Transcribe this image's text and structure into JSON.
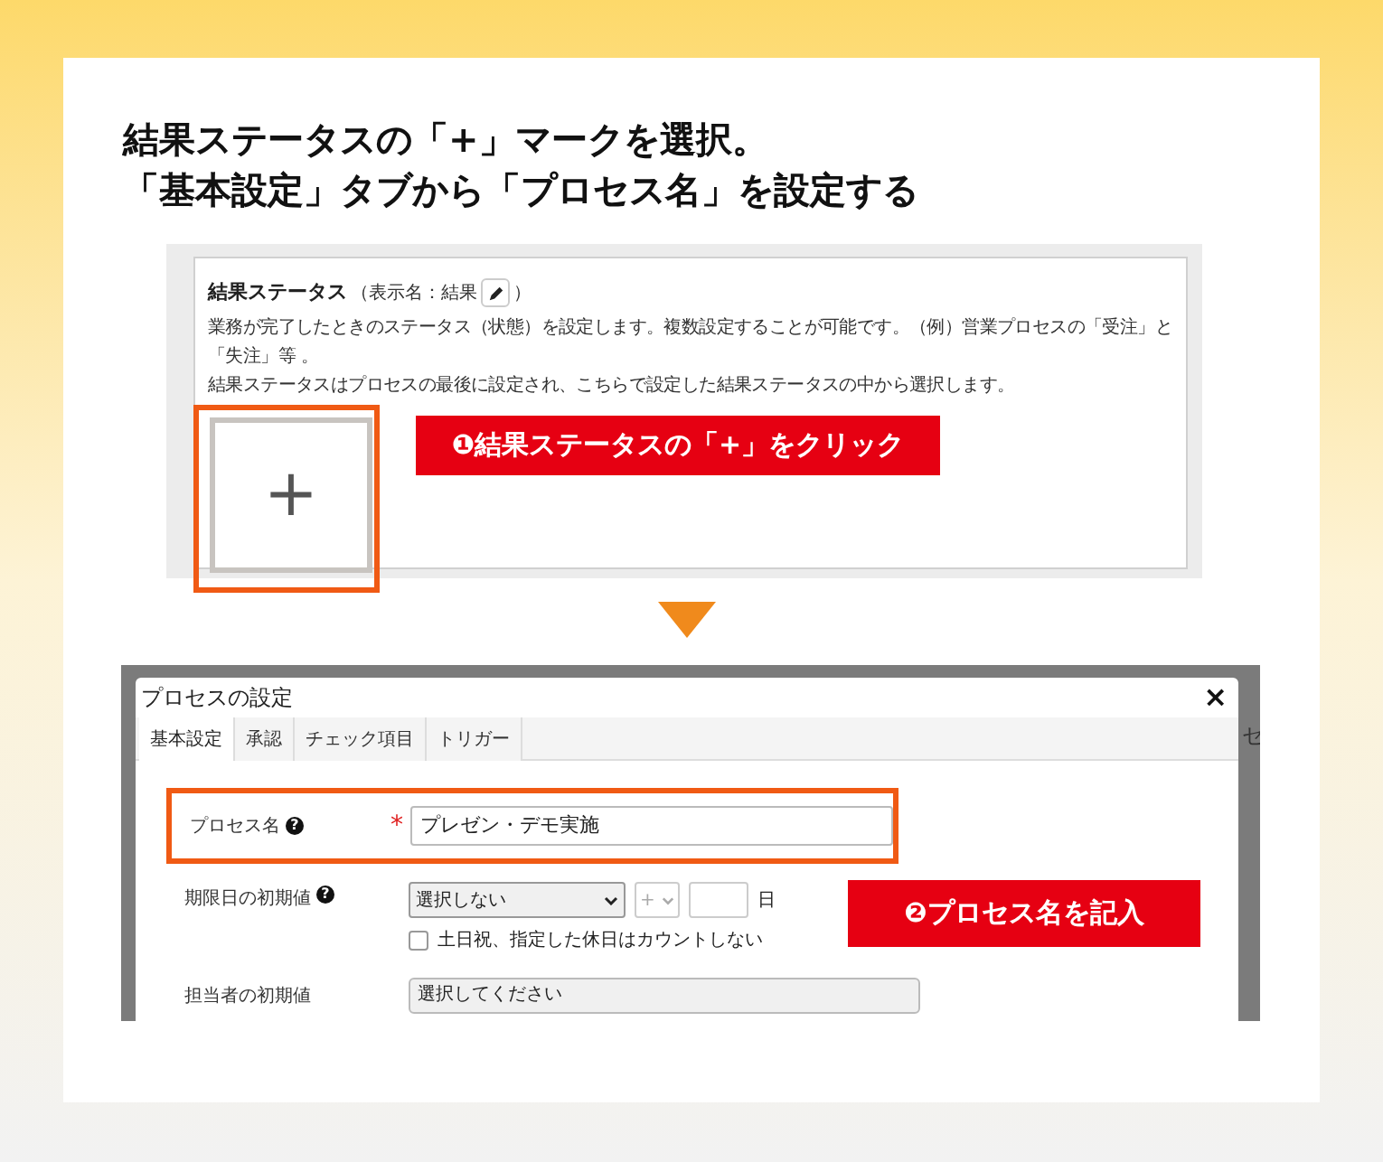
{
  "heading": [
    "結果ステータスの「+」マークを選択。",
    "「基本設定」タブから「プロセス名」を設定する"
  ],
  "screen1": {
    "section_title": "結果ステータス",
    "display_name": "（表示名：結果",
    "close_paren": "）",
    "description": [
      "業務が完了したときのステータス（状態）を設定します。複数設定することが可能です。（例）営業プロセスの「受注」と「失注」等 。",
      "結果ステータスはプロセスの最後に設定され、こちらで設定した結果ステータスの中から選択します。"
    ],
    "add_button": "+",
    "callout": "❶結果ステータスの「+」をクリック"
  },
  "screen2": {
    "backdrop_right": "セ",
    "dialog_title": "プロセスの設定",
    "close": "×",
    "tabs": [
      {
        "label": "基本設定",
        "selected": true
      },
      {
        "label": "承認",
        "selected": false
      },
      {
        "label": "チェック項目",
        "selected": false
      },
      {
        "label": "トリガー",
        "selected": false
      }
    ],
    "fields": [
      {
        "kind": "text",
        "label": "プロセス名",
        "help": "?",
        "required_mark": "*",
        "value": "プレゼン・デモ実施"
      },
      {
        "kind": "due",
        "label": "期限日の初期値",
        "help": "?",
        "select": "選択しない",
        "sign": "+",
        "unit": "日",
        "checkbox": {
          "label": "土日祝、指定した休日はカウントしない",
          "checked": false
        }
      },
      {
        "kind": "picker",
        "label": "担当者の初期値",
        "value": "選択してください"
      }
    ],
    "callout": "❷プロセス名を記入"
  }
}
